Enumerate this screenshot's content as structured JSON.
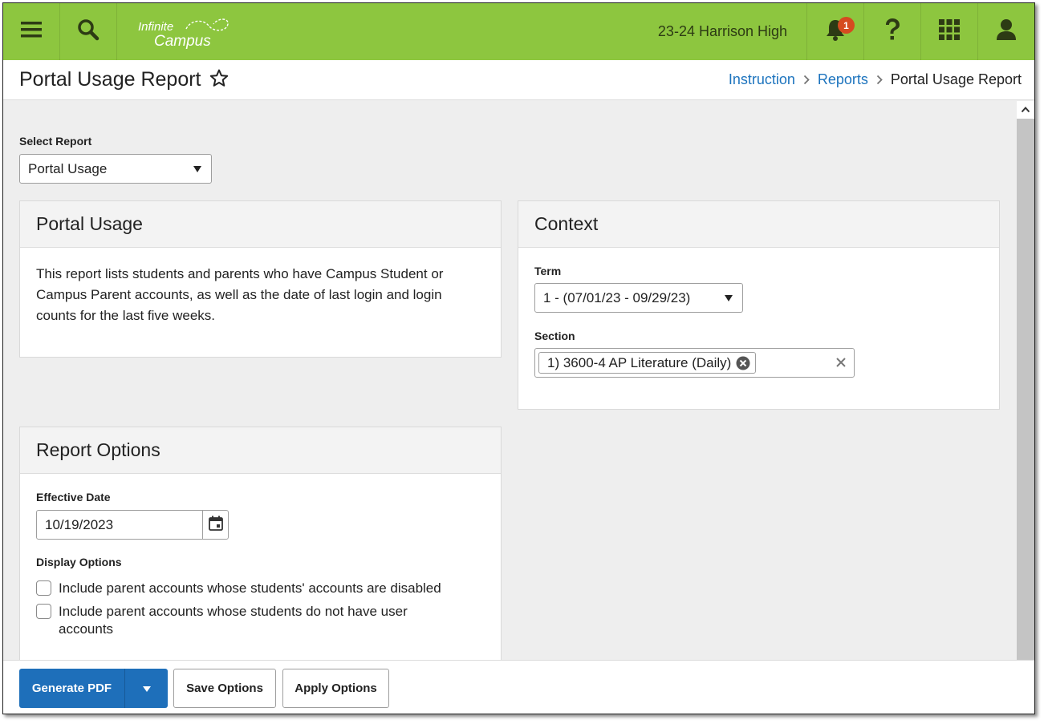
{
  "topbar": {
    "logo_line1": "Infinite",
    "logo_line2": "Campus",
    "school": "23-24 Harrison High",
    "notification_count": "1",
    "bar_color": "#8dc63f"
  },
  "header": {
    "title": "Portal Usage Report",
    "breadcrumb": [
      "Instruction",
      "Reports",
      "Portal Usage Report"
    ]
  },
  "select_report": {
    "label": "Select Report",
    "value": "Portal Usage"
  },
  "portal_usage": {
    "title": "Portal Usage",
    "description": "This report lists students and parents who have Campus Student or Campus Parent accounts, as well as the date of last login and login counts for the last five weeks."
  },
  "context": {
    "title": "Context",
    "term_label": "Term",
    "term_value": "1 - (07/01/23 - 09/29/23)",
    "section_label": "Section",
    "section_value": "1) 3600-4 AP Literature (Daily)"
  },
  "report_options": {
    "title": "Report Options",
    "effective_date_label": "Effective Date",
    "effective_date_value": "10/19/2023",
    "display_options_label": "Display Options",
    "options": [
      "Include parent accounts whose students' accounts are disabled",
      "Include parent accounts whose students do not have user accounts"
    ]
  },
  "footer": {
    "generate_pdf": "Generate PDF",
    "save_options": "Save Options",
    "apply_options": "Apply Options",
    "primary_color": "#1e6fba"
  }
}
